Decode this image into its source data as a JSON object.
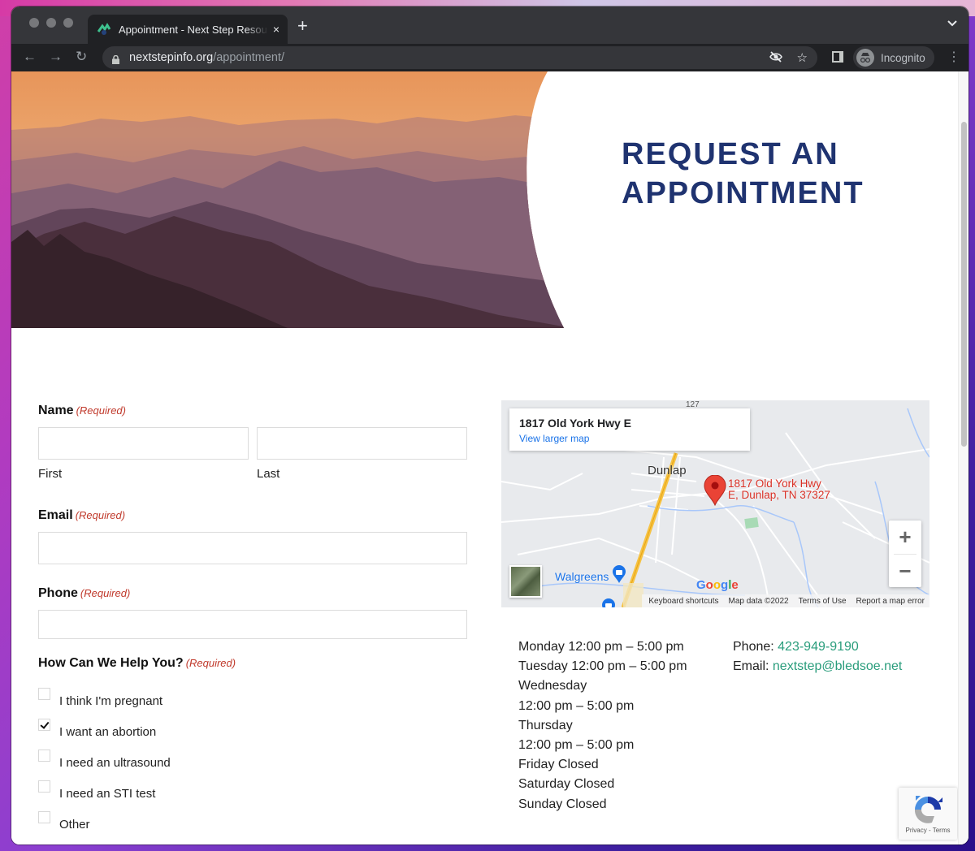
{
  "browser": {
    "tab_title": "Appointment - Next Step Resources",
    "tab_close": "×",
    "new_tab": "+",
    "tab_menu": "⌄",
    "url_domain": "nextstepinfo.org",
    "url_path": "/appointment/",
    "profile_label": "Incognito",
    "nav": {
      "back": "←",
      "forward": "→",
      "reload": "↻"
    },
    "icons": {
      "eye_off": "⊘",
      "star": "☆",
      "menu": "⋮"
    }
  },
  "hero": {
    "title_line1": "REQUEST AN",
    "title_line2": "APPOINTMENT"
  },
  "form": {
    "required_text": "(Required)",
    "name": {
      "label": "Name",
      "first_sub": "First",
      "last_sub": "Last",
      "first_value": "",
      "last_value": ""
    },
    "email": {
      "label": "Email",
      "value": ""
    },
    "phone": {
      "label": "Phone",
      "value": ""
    },
    "help": {
      "label": "How Can We Help You?",
      "options": [
        {
          "label": "I think I'm pregnant",
          "checked": false
        },
        {
          "label": "I want an abortion",
          "checked": true
        },
        {
          "label": "I need an ultrasound",
          "checked": false
        },
        {
          "label": "I need an STI test",
          "checked": false
        },
        {
          "label": "Other",
          "checked": false
        }
      ]
    }
  },
  "map": {
    "card_address": "1817 Old York Hwy E",
    "card_link": "View larger map",
    "town": "Dunlap",
    "pin_label_line1": "1817 Old York Hwy",
    "pin_label_line2": "E, Dunlap, TN 37327",
    "poi": "Walgreens",
    "route": "127",
    "zoom_in": "+",
    "zoom_out": "−",
    "footer": [
      "Keyboard shortcuts",
      "Map data ©2022",
      "Terms of Use",
      "Report a map error"
    ]
  },
  "hours": [
    "Monday 12:00 pm – 5:00 pm",
    "Tuesday 12:00 pm – 5:00 pm",
    "Wednesday",
    "12:00 pm – 5:00 pm",
    "Thursday",
    "12:00 pm – 5:00 pm",
    "Friday Closed",
    "Saturday Closed",
    "Sunday Closed"
  ],
  "contact": {
    "phone_label": "Phone: ",
    "phone": "423-949-9190",
    "email_label": "Email: ",
    "email": "nextstep@bledsoe.net"
  },
  "recaptcha": {
    "text": "Privacy - Terms"
  },
  "colors": {
    "heading": "#1f3370",
    "required": "#c0392b",
    "link_green": "#2a9d7c",
    "map_link": "#1a73e8",
    "pin": "#d93025"
  }
}
